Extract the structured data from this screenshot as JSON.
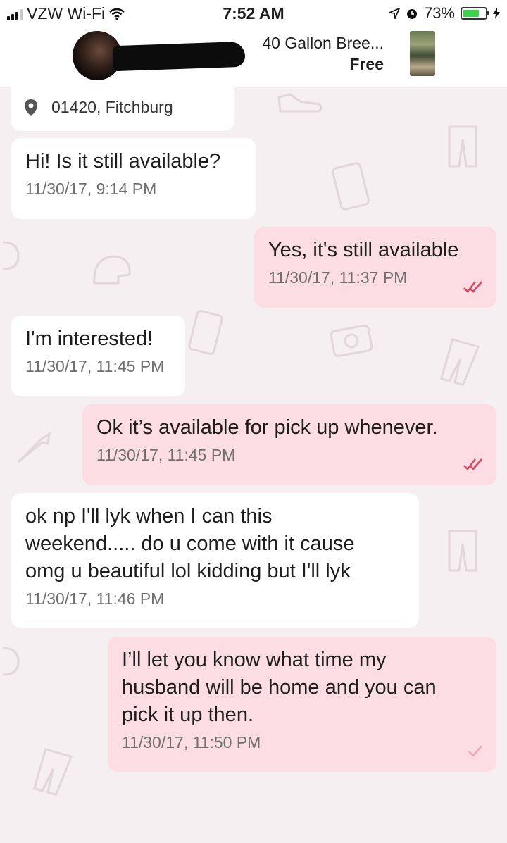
{
  "status_bar": {
    "carrier": "VZW Wi-Fi",
    "time": "7:52 AM",
    "battery": "73%",
    "battery_level": 0.73
  },
  "header": {
    "product_title": "40 Gallon Bree...",
    "price": "Free"
  },
  "location": {
    "text": "01420, Fitchburg"
  },
  "messages": [
    {
      "direction": "incoming",
      "text": "Hi! Is it still available?",
      "timestamp": "11/30/17, 9:14 PM"
    },
    {
      "direction": "outgoing",
      "text": "Yes, it's still available",
      "timestamp": "11/30/17, 11:37 PM",
      "status": "read"
    },
    {
      "direction": "incoming",
      "text": "I'm interested!",
      "timestamp": "11/30/17, 11:45 PM"
    },
    {
      "direction": "outgoing",
      "text": "Ok it’s available for pick up whenever.",
      "timestamp": "11/30/17, 11:45 PM",
      "status": "read"
    },
    {
      "direction": "incoming",
      "text": "ok np I'll lyk when I can this\nweekend..... do u come with it cause\nomg u beautiful lol kidding but I'll lyk",
      "timestamp": "11/30/17, 11:46 PM"
    },
    {
      "direction": "outgoing",
      "text": "I’ll let you know what time my\nhusband will be home and you can\npick it up then.",
      "timestamp": "11/30/17, 11:50 PM",
      "status": "sent"
    }
  ],
  "colors": {
    "outgoing_bubble": "#fbdde3",
    "incoming_bubble": "#ffffff",
    "background": "#f6eff1",
    "tick": "#e0455e"
  }
}
